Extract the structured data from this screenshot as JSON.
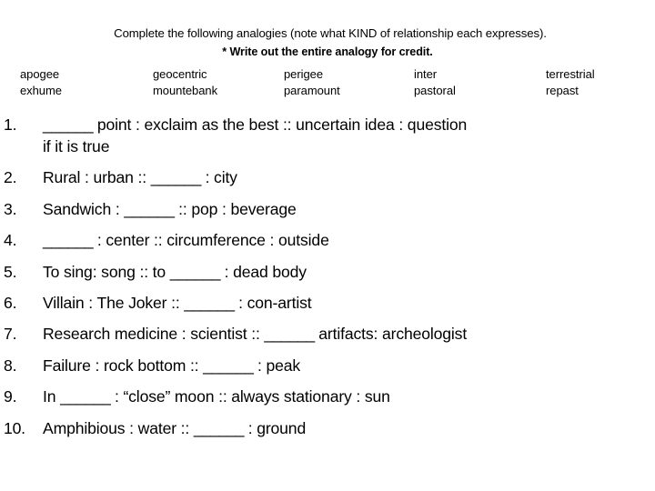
{
  "document": {
    "type": "analogies-worksheet",
    "background_color": "#ffffff",
    "text_color": "#000000"
  },
  "header": {
    "instruction": "Complete the following analogies (note what KIND of relationship each expresses).",
    "credit_note": "* Write out the entire analogy for credit."
  },
  "word_bank": {
    "columns": 5,
    "rows": 2,
    "words": [
      "apogee",
      "geocentric",
      "perigee",
      "inter",
      "terrestrial",
      "exhume",
      "mountebank",
      "paramount",
      "pastoral",
      "repast"
    ]
  },
  "questions": [
    {
      "number": "1.",
      "lines": [
        "______ point : exclaim as the best :: uncertain idea : question",
        "if it is true"
      ]
    },
    {
      "number": "2.",
      "lines": [
        "Rural : urban :: ______ : city"
      ]
    },
    {
      "number": "3.",
      "lines": [
        "Sandwich : ______ :: pop : beverage"
      ]
    },
    {
      "number": "4.",
      "lines": [
        "______ :  center ::  circumference : outside"
      ]
    },
    {
      "number": "5.",
      "lines": [
        "To sing: song :: to ______ : dead body"
      ]
    },
    {
      "number": "6.",
      "lines": [
        "Villain : The Joker ::  ______ : con-artist"
      ]
    },
    {
      "number": "7.",
      "lines": [
        "Research medicine : scientist :: ______  artifacts: archeologist"
      ]
    },
    {
      "number": "8.",
      "lines": [
        "Failure : rock bottom ::  ______  : peak"
      ]
    },
    {
      "number": "9.",
      "lines": [
        "In ______ : “close” moon :: always stationary : sun"
      ]
    },
    {
      "number": "10.",
      "lines": [
        "Amphibious : water :: ______ : ground"
      ]
    }
  ]
}
